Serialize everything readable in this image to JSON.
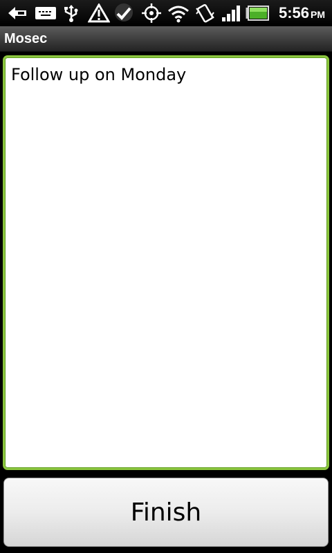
{
  "status_bar": {
    "time": "5:56",
    "ampm": "PM",
    "icons": [
      "back-notification-icon",
      "keyboard-icon",
      "usb-icon",
      "warning-icon",
      "sync-check-icon",
      "gps-icon",
      "wifi-icon",
      "vibrate-icon",
      "signal-icon",
      "battery-icon"
    ],
    "battery_color": "#4caf28"
  },
  "title_bar": {
    "title": "Mosec"
  },
  "note": {
    "value": "Follow up on Monday",
    "border_color": "#8cc63f"
  },
  "finish_button": {
    "label": "Finish"
  }
}
